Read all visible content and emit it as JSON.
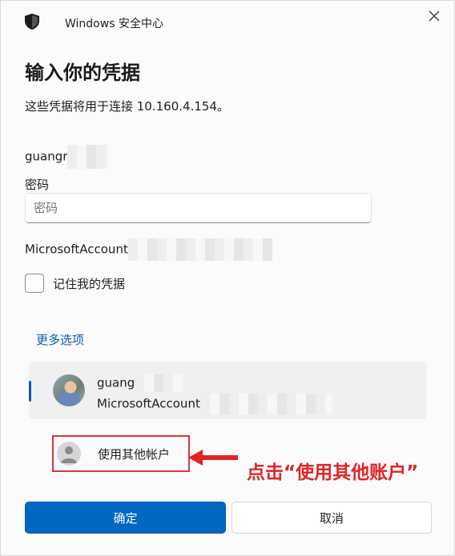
{
  "window": {
    "app_title": "Windows 安全中心",
    "close_icon": "close-icon",
    "app_icon": "shield-icon"
  },
  "dialog": {
    "heading": "输入你的凭据",
    "subtitle": "这些凭据将用于连接 10.160.4.154。",
    "username": "guangr",
    "password_label": "密码",
    "password_placeholder": "密码",
    "password_value": "",
    "account_prefix": "MicrosoftAccount",
    "remember_label": "记住我的凭据",
    "remember_checked": false,
    "more_options": "更多选项"
  },
  "accounts": {
    "selected": {
      "name": "guang",
      "subtitle": "MicrosoftAccount"
    },
    "other": {
      "label": "使用其他帐户",
      "icon": "person-icon"
    }
  },
  "annotation": {
    "text": "点击“使用其他账户”",
    "color": "#e02424",
    "icon": "arrow-left-icon"
  },
  "buttons": {
    "ok": "确定",
    "cancel": "取消"
  },
  "colors": {
    "accent": "#0067c0",
    "link": "#0b5cad",
    "highlight_box": "#d9363e"
  }
}
